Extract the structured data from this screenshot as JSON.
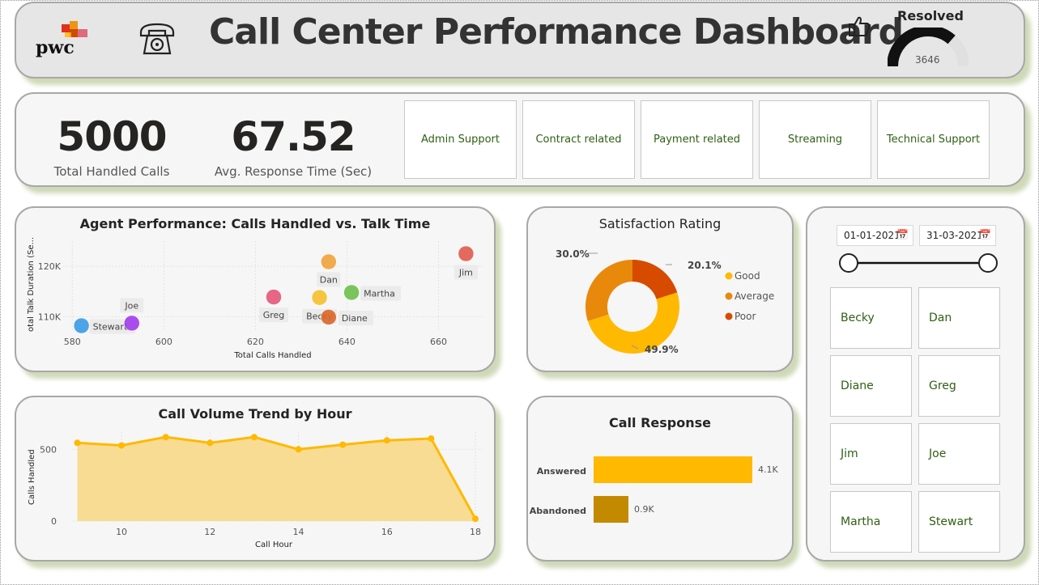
{
  "header": {
    "logo_text": "pwc",
    "title": "Call Center Performance Dashboard",
    "resolved_label": "Resolved",
    "resolved_value": "3646",
    "resolved_fraction": 0.73,
    "icons": [
      "phone-icon",
      "thumbs-up-icon"
    ]
  },
  "kpis": {
    "total_calls_value": "5000",
    "total_calls_label": "Total Handled Calls",
    "avg_response_value": "67.52",
    "avg_response_label": "Avg. Response Time (Sec)"
  },
  "categories": [
    "Admin Support",
    "Contract related",
    "Payment related",
    "Streaming",
    "Technical Support"
  ],
  "scatter": {
    "title": "Agent Performance: Calls Handled vs. Talk Time",
    "xlabel": "Total Calls Handled",
    "ylabel": "otal Talk Duration (Se...",
    "x_ticks": [
      "580",
      "600",
      "620",
      "640",
      "660"
    ],
    "y_ticks": [
      "120K",
      "110K"
    ]
  },
  "donut": {
    "title": "Satisfaction Rating",
    "labels": [
      "30.0%",
      "20.1%",
      "49.9%"
    ],
    "legend": [
      "Good",
      "Average",
      "Poor"
    ]
  },
  "trend": {
    "title": "Call Volume Trend by Hour",
    "xlabel": "Call Hour",
    "ylabel": "Calls Handled",
    "x_ticks": [
      "10",
      "12",
      "14",
      "16",
      "18"
    ],
    "y_ticks": [
      "500",
      "0"
    ]
  },
  "response": {
    "title": "Call Response",
    "labels": [
      "Answered",
      "Abandoned"
    ],
    "value_labels": [
      "4.1K",
      "0.9K"
    ]
  },
  "slicer": {
    "start_date": "01-01-2021",
    "end_date": "31-03-2021",
    "agents": [
      "Becky",
      "Dan",
      "Diane",
      "Greg",
      "Jim",
      "Joe",
      "Martha",
      "Stewart"
    ]
  },
  "colors": {
    "good": "#FFB900",
    "average": "#E8890C",
    "poor": "#D64B00",
    "abandoned": "#C38A00",
    "area_fill": "#F8DC94",
    "card_shadow": "#cfd9b8",
    "category_text": "#2f5f14"
  },
  "chart_data": [
    {
      "type": "scatter",
      "title": "Agent Performance: Calls Handled vs. Talk Time",
      "xlabel": "Total Calls Handled",
      "ylabel": "otal Talk Duration (Se...",
      "xlim": [
        578,
        670
      ],
      "ylim": [
        107000,
        125000
      ],
      "grid": true,
      "points": [
        {
          "name": "Stewart",
          "x": 582,
          "y": 108200,
          "color": "#3A9BE6"
        },
        {
          "name": "Joe",
          "x": 593,
          "y": 108700,
          "color": "#A23BEC"
        },
        {
          "name": "Greg",
          "x": 624,
          "y": 113900,
          "color": "#E6577A"
        },
        {
          "name": "Becky",
          "x": 634,
          "y": 113800,
          "color": "#F5C02C"
        },
        {
          "name": "Dan",
          "x": 636,
          "y": 120900,
          "color": "#F1A33A"
        },
        {
          "name": "Diane",
          "x": 636,
          "y": 109900,
          "color": "#D9672A"
        },
        {
          "name": "Martha",
          "x": 641,
          "y": 114800,
          "color": "#6BC04B"
        },
        {
          "name": "Jim",
          "x": 666,
          "y": 122500,
          "color": "#E15A4F"
        }
      ]
    },
    {
      "type": "pie",
      "title": "Satisfaction Rating",
      "categories": [
        "Good",
        "Average",
        "Poor"
      ],
      "values": [
        49.9,
        30.0,
        20.1
      ],
      "legend_position": "right"
    },
    {
      "type": "area",
      "title": "Call Volume Trend by Hour",
      "xlabel": "Call Hour",
      "ylabel": "Calls Handled",
      "x": [
        9,
        10,
        11,
        12,
        13,
        14,
        15,
        16,
        17,
        18
      ],
      "values": [
        545,
        527,
        585,
        545,
        585,
        500,
        532,
        562,
        575,
        16
      ],
      "xlim": [
        8.9,
        18
      ],
      "ylim": [
        0,
        620
      ],
      "grid": true
    },
    {
      "type": "bar",
      "title": "Call Response",
      "categories": [
        "Answered",
        "Abandoned"
      ],
      "values": [
        4100,
        900
      ],
      "value_labels": [
        "4.1K",
        "0.9K"
      ],
      "orientation": "horizontal"
    }
  ]
}
